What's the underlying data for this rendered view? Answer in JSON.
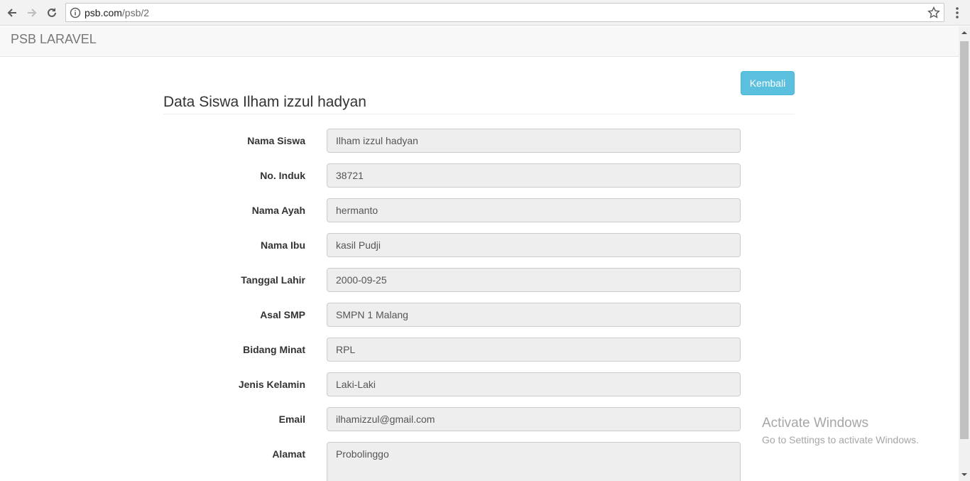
{
  "browser": {
    "url_host": "psb.com",
    "url_path": "/psb/2"
  },
  "navbar": {
    "brand": "PSB LARAVEL"
  },
  "page": {
    "back_button": "Kembali",
    "title": "Data Siswa Ilham izzul hadyan"
  },
  "fields": [
    {
      "label": "Nama Siswa",
      "value": "Ilham izzul hadyan"
    },
    {
      "label": "No. Induk",
      "value": "38721"
    },
    {
      "label": "Nama Ayah",
      "value": "hermanto"
    },
    {
      "label": "Nama Ibu",
      "value": "kasil Pudji"
    },
    {
      "label": "Tanggal Lahir",
      "value": "2000-09-25"
    },
    {
      "label": "Asal SMP",
      "value": "SMPN 1 Malang"
    },
    {
      "label": "Bidang Minat",
      "value": "RPL"
    },
    {
      "label": "Jenis Kelamin",
      "value": "Laki-Laki"
    },
    {
      "label": "Email",
      "value": "ilhamizzul@gmail.com"
    },
    {
      "label": "Alamat",
      "value": "Probolinggo"
    }
  ],
  "watermark": {
    "title": "Activate Windows",
    "subtitle": "Go to Settings to activate Windows."
  },
  "colors": {
    "button_info": "#5bc0de",
    "input_readonly_bg": "#eeeeee",
    "navbar_bg": "#f8f8f8"
  },
  "icons": [
    "back-arrow-icon",
    "forward-arrow-icon",
    "reload-icon",
    "info-icon",
    "star-icon",
    "kebab-menu-icon"
  ]
}
